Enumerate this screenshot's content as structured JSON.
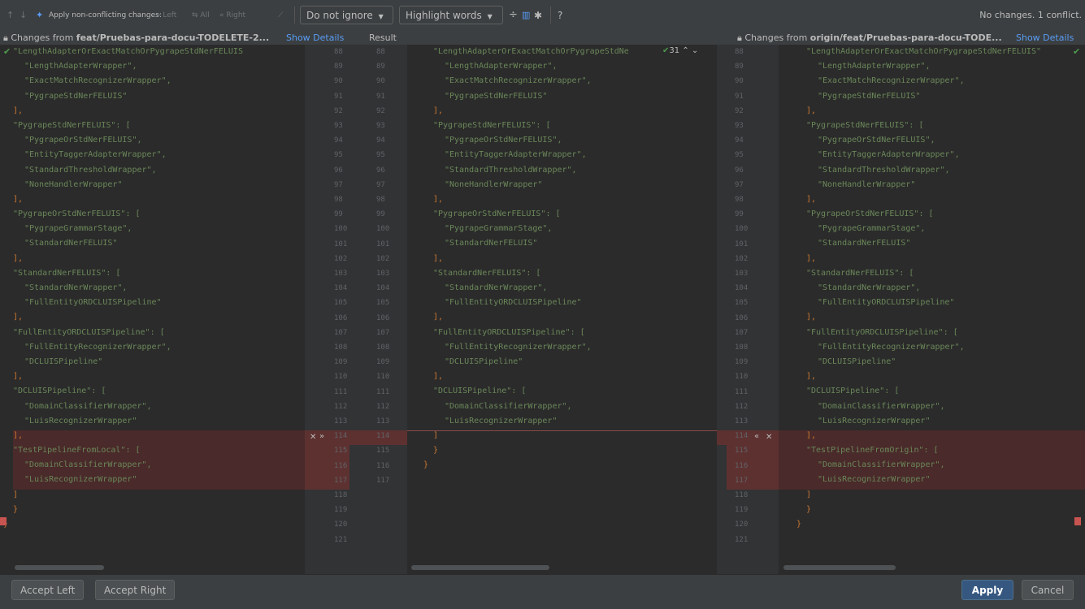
{
  "toolbar": {
    "apply_nonconflicting_label": "Apply non-conflicting changes:",
    "left_label": "Left",
    "all_label": "All",
    "right_label": "Right",
    "ignore_select": "Do not ignore",
    "highlight_select": "Highlight words",
    "help_label": "?",
    "status": "No changes. 1 conflict."
  },
  "titles": {
    "left_prefix": "Changes from ",
    "left_branch": "feat/Pruebas-para-docu-TODELETE-2...",
    "left_show": "Show Details",
    "center": "Result",
    "right_prefix": "Changes from ",
    "right_branch": "origin/feat/Pruebas-para-docu-TODE...",
    "right_show": "Show Details"
  },
  "editor": {
    "counter": "31",
    "left_lines": [
      "\"LengthAdapterOrExactMatchOrPygrapeStdNerFELUIS",
      "\"LengthAdapterWrapper\",",
      "\"ExactMatchRecognizerWrapper\",",
      "\"PygrapeStdNerFELUIS\"",
      "],",
      "\"PygrapeStdNerFELUIS\": [",
      "\"PygrapeOrStdNerFELUIS\",",
      "\"EntityTaggerAdapterWrapper\",",
      "\"StandardThresholdWrapper\",",
      "\"NoneHandlerWrapper\"",
      "],",
      "\"PygrapeOrStdNerFELUIS\": [",
      "\"PygrapeGrammarStage\",",
      "\"StandardNerFELUIS\"",
      "],",
      "\"StandardNerFELUIS\": [",
      "\"StandardNerWrapper\",",
      "\"FullEntityORDCLUISPipeline\"",
      "],",
      "\"FullEntityORDCLUISPipeline\": [",
      "\"FullEntityRecognizerWrapper\",",
      "\"DCLUISPipeline\"",
      "],",
      "\"DCLUISPipeline\": [",
      "\"DomainClassifierWrapper\",",
      "\"LuisRecognizerWrapper\"",
      "],",
      "\"TestPipelineFromLocal\": [",
      "\"DomainClassifierWrapper\",",
      "\"LuisRecognizerWrapper\"",
      "]",
      "}",
      "}"
    ],
    "center_lines": [
      "\"LengthAdapterOrExactMatchOrPygrapeStdNe",
      "\"LengthAdapterWrapper\",",
      "\"ExactMatchRecognizerWrapper\",",
      "\"PygrapeStdNerFELUIS\"",
      "],",
      "\"PygrapeStdNerFELUIS\": [",
      "\"PygrapeOrStdNerFELUIS\",",
      "\"EntityTaggerAdapterWrapper\",",
      "\"StandardThresholdWrapper\",",
      "\"NoneHandlerWrapper\"",
      "],",
      "\"PygrapeOrStdNerFELUIS\": [",
      "\"PygrapeGrammarStage\",",
      "\"StandardNerFELUIS\"",
      "],",
      "\"StandardNerFELUIS\": [",
      "\"StandardNerWrapper\",",
      "\"FullEntityORDCLUISPipeline\"",
      "],",
      "\"FullEntityORDCLUISPipeline\": [",
      "\"FullEntityRecognizerWrapper\",",
      "\"DCLUISPipeline\"",
      "],",
      "\"DCLUISPipeline\": [",
      "\"DomainClassifierWrapper\",",
      "\"LuisRecognizerWrapper\"",
      "]",
      "}",
      "}"
    ],
    "right_lines": [
      "\"LengthAdapterOrExactMatchOrPygrapeStdNerFELUIS\"",
      "\"LengthAdapterWrapper\",",
      "\"ExactMatchRecognizerWrapper\",",
      "\"PygrapeStdNerFELUIS\"",
      "],",
      "\"PygrapeStdNerFELUIS\": [",
      "\"PygrapeOrStdNerFELUIS\",",
      "\"EntityTaggerAdapterWrapper\",",
      "\"StandardThresholdWrapper\",",
      "\"NoneHandlerWrapper\"",
      "],",
      "\"PygrapeOrStdNerFELUIS\": [",
      "\"PygrapeGrammarStage\",",
      "\"StandardNerFELUIS\"",
      "],",
      "\"StandardNerFELUIS\": [",
      "\"StandardNerWrapper\",",
      "\"FullEntityORDCLUISPipeline\"",
      "],",
      "\"FullEntityORDCLUISPipeline\": [",
      "\"FullEntityRecognizerWrapper\",",
      "\"DCLUISPipeline\"",
      "],",
      "\"DCLUISPipeline\": [",
      "\"DomainClassifierWrapper\",",
      "\"LuisRecognizerWrapper\"",
      "],",
      "\"TestPipelineFromOrigin\": [",
      "\"DomainClassifierWrapper\",",
      "\"LuisRecognizerWrapper\"",
      "]",
      "}",
      "}"
    ],
    "left_numbers": [
      "88",
      "89",
      "90",
      "91",
      "92",
      "93",
      "94",
      "95",
      "96",
      "97",
      "98",
      "99",
      "100",
      "101",
      "102",
      "103",
      "104",
      "105",
      "106",
      "107",
      "108",
      "109",
      "110",
      "111",
      "112",
      "113",
      "114",
      "115",
      "116",
      "117",
      "118",
      "119",
      "120",
      "121"
    ],
    "center_numbers": [
      "88",
      "89",
      "90",
      "91",
      "92",
      "93",
      "94",
      "95",
      "96",
      "97",
      "98",
      "99",
      "100",
      "101",
      "102",
      "103",
      "104",
      "105",
      "106",
      "107",
      "108",
      "109",
      "110",
      "111",
      "112",
      "113",
      "114",
      "115",
      "116",
      "117"
    ],
    "right_numbers": [
      "88",
      "89",
      "90",
      "91",
      "92",
      "93",
      "94",
      "95",
      "96",
      "97",
      "98",
      "99",
      "100",
      "101",
      "102",
      "103",
      "104",
      "105",
      "106",
      "107",
      "108",
      "109",
      "110",
      "111",
      "112",
      "113",
      "114",
      "115",
      "116",
      "117",
      "118",
      "119",
      "120",
      "121"
    ]
  },
  "bottom": {
    "accept_left": "Accept Left",
    "accept_right": "Accept Right",
    "apply": "Apply",
    "cancel": "Cancel"
  },
  "colors": {
    "background": "#2b2b2b",
    "string": "#6a8759",
    "conflict": "#4a2a2a",
    "accent": "#365880"
  }
}
